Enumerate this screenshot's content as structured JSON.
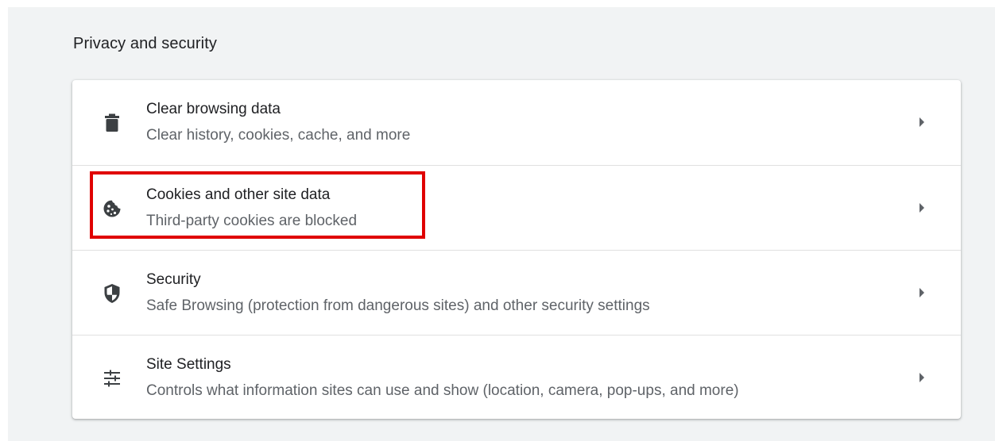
{
  "section": {
    "title": "Privacy and security"
  },
  "rows": [
    {
      "label": "Clear browsing data",
      "sublabel": "Clear history, cookies, cache, and more",
      "icon": "trash-icon"
    },
    {
      "label": "Cookies and other site data",
      "sublabel": "Third-party cookies are blocked",
      "icon": "cookie-icon"
    },
    {
      "label": "Security",
      "sublabel": "Safe Browsing (protection from dangerous sites) and other security settings",
      "icon": "shield-icon"
    },
    {
      "label": "Site Settings",
      "sublabel": "Controls what information sites can use and show (location, camera, pop-ups, and more)",
      "icon": "tune-icon"
    }
  ],
  "colors": {
    "background": "#f1f3f4",
    "card": "#ffffff",
    "primary_text": "#202124",
    "secondary_text": "#5f6368",
    "icon": "#3c4043",
    "highlight": "#e00000"
  }
}
